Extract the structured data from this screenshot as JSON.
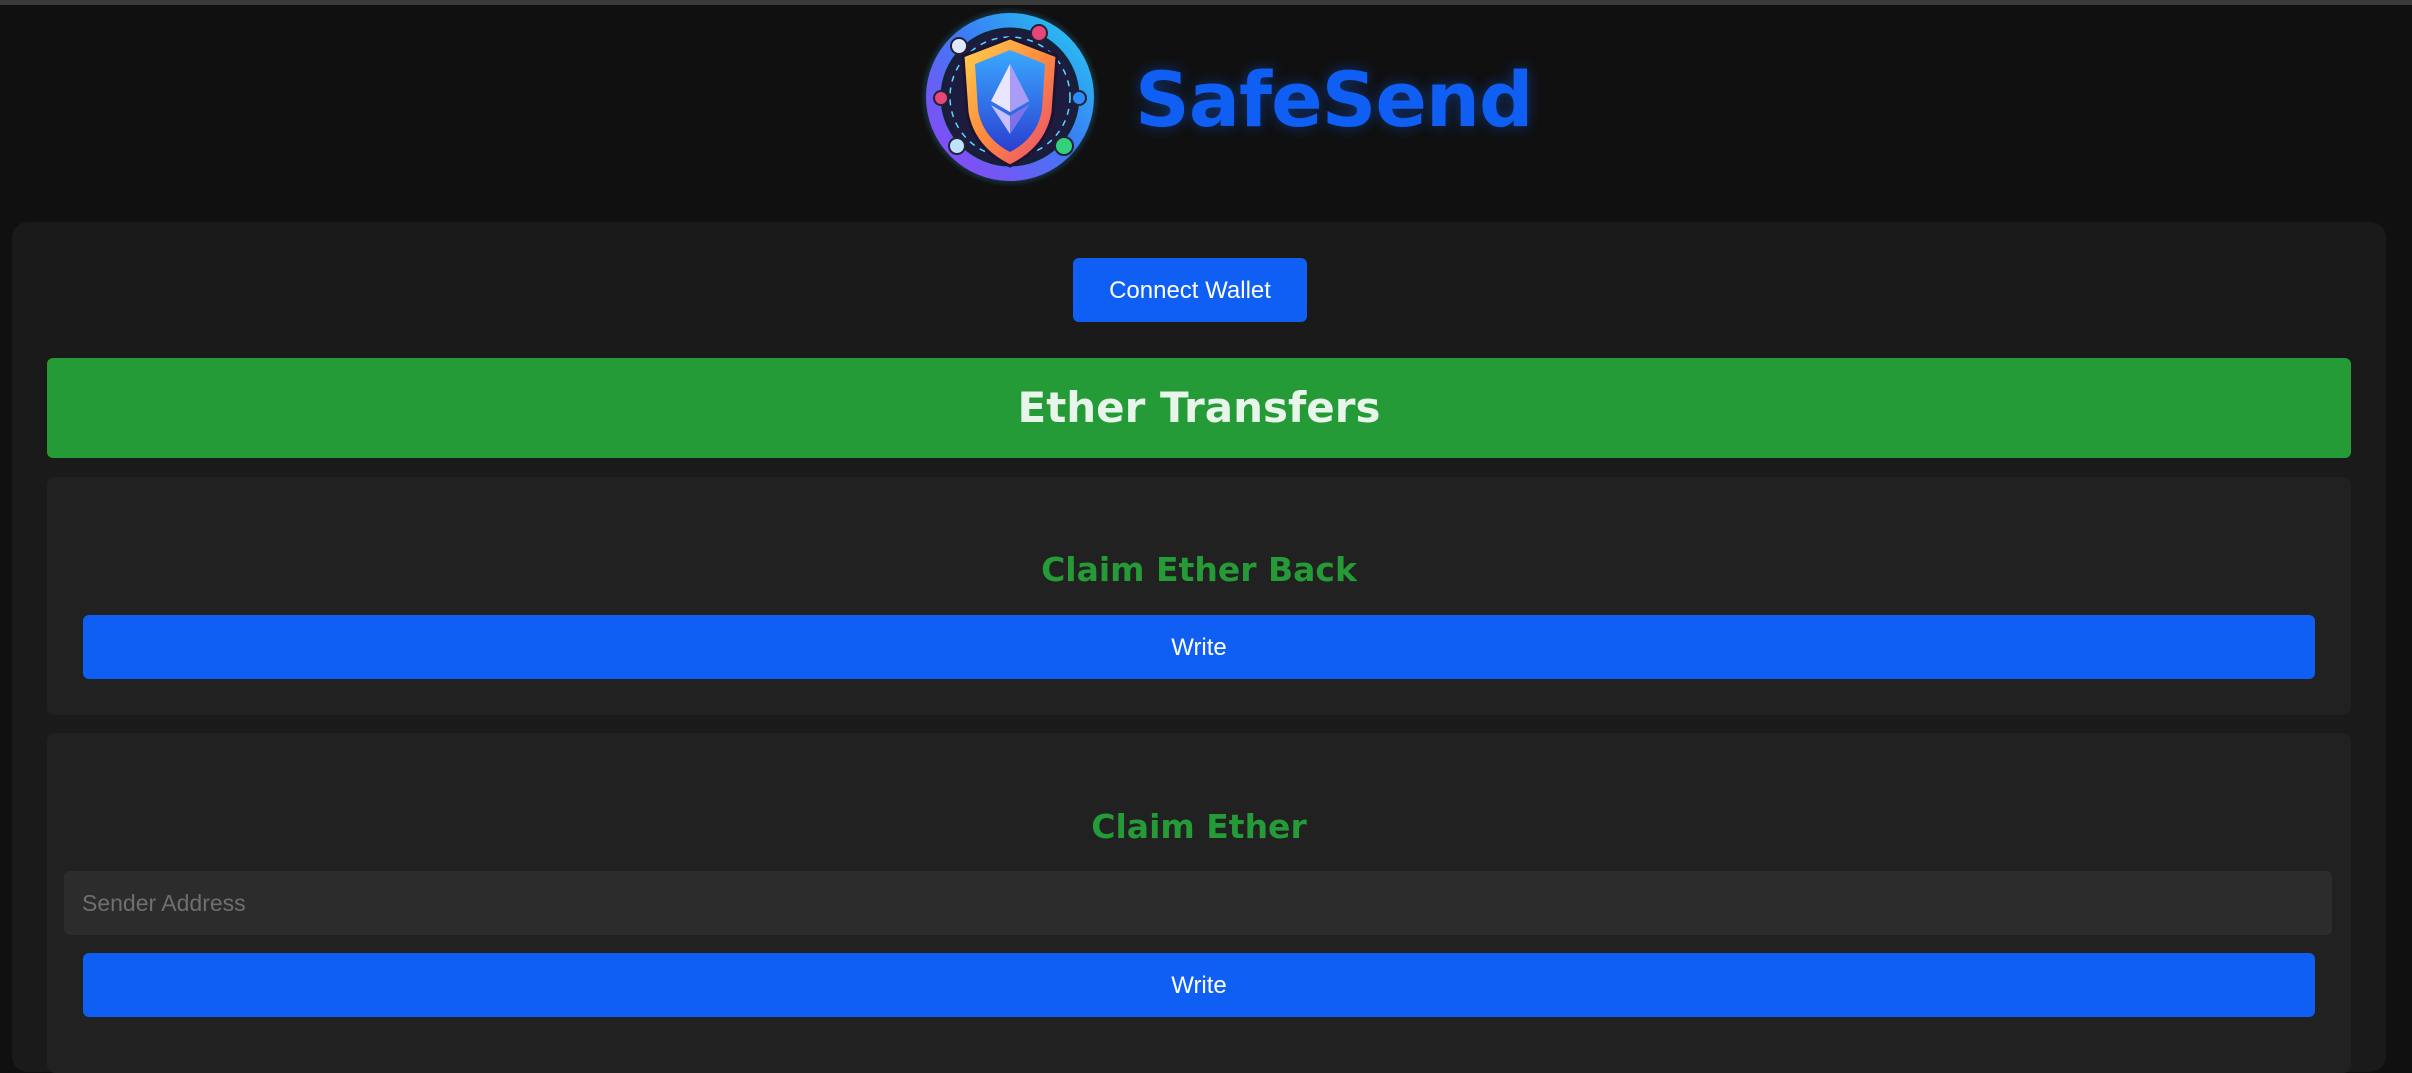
{
  "header": {
    "brand_name": "SafeSend",
    "logo_icon": "shield-ethereum-logo-icon",
    "brand_color": "#0f5ff5"
  },
  "wallet": {
    "connect_label": "Connect Wallet"
  },
  "section": {
    "title": "Ether Transfers",
    "banner_color": "#249b36"
  },
  "cards": [
    {
      "title": "Claim Ether Back",
      "button_label": "Write"
    },
    {
      "title": "Claim Ether",
      "input_placeholder": "Sender Address",
      "input_value": "",
      "button_label": "Write"
    }
  ],
  "colors": {
    "background": "#101010",
    "panel": "#1a1a1a",
    "card": "#212121",
    "accent_blue": "#0f5ff5",
    "accent_green": "#249b36"
  }
}
